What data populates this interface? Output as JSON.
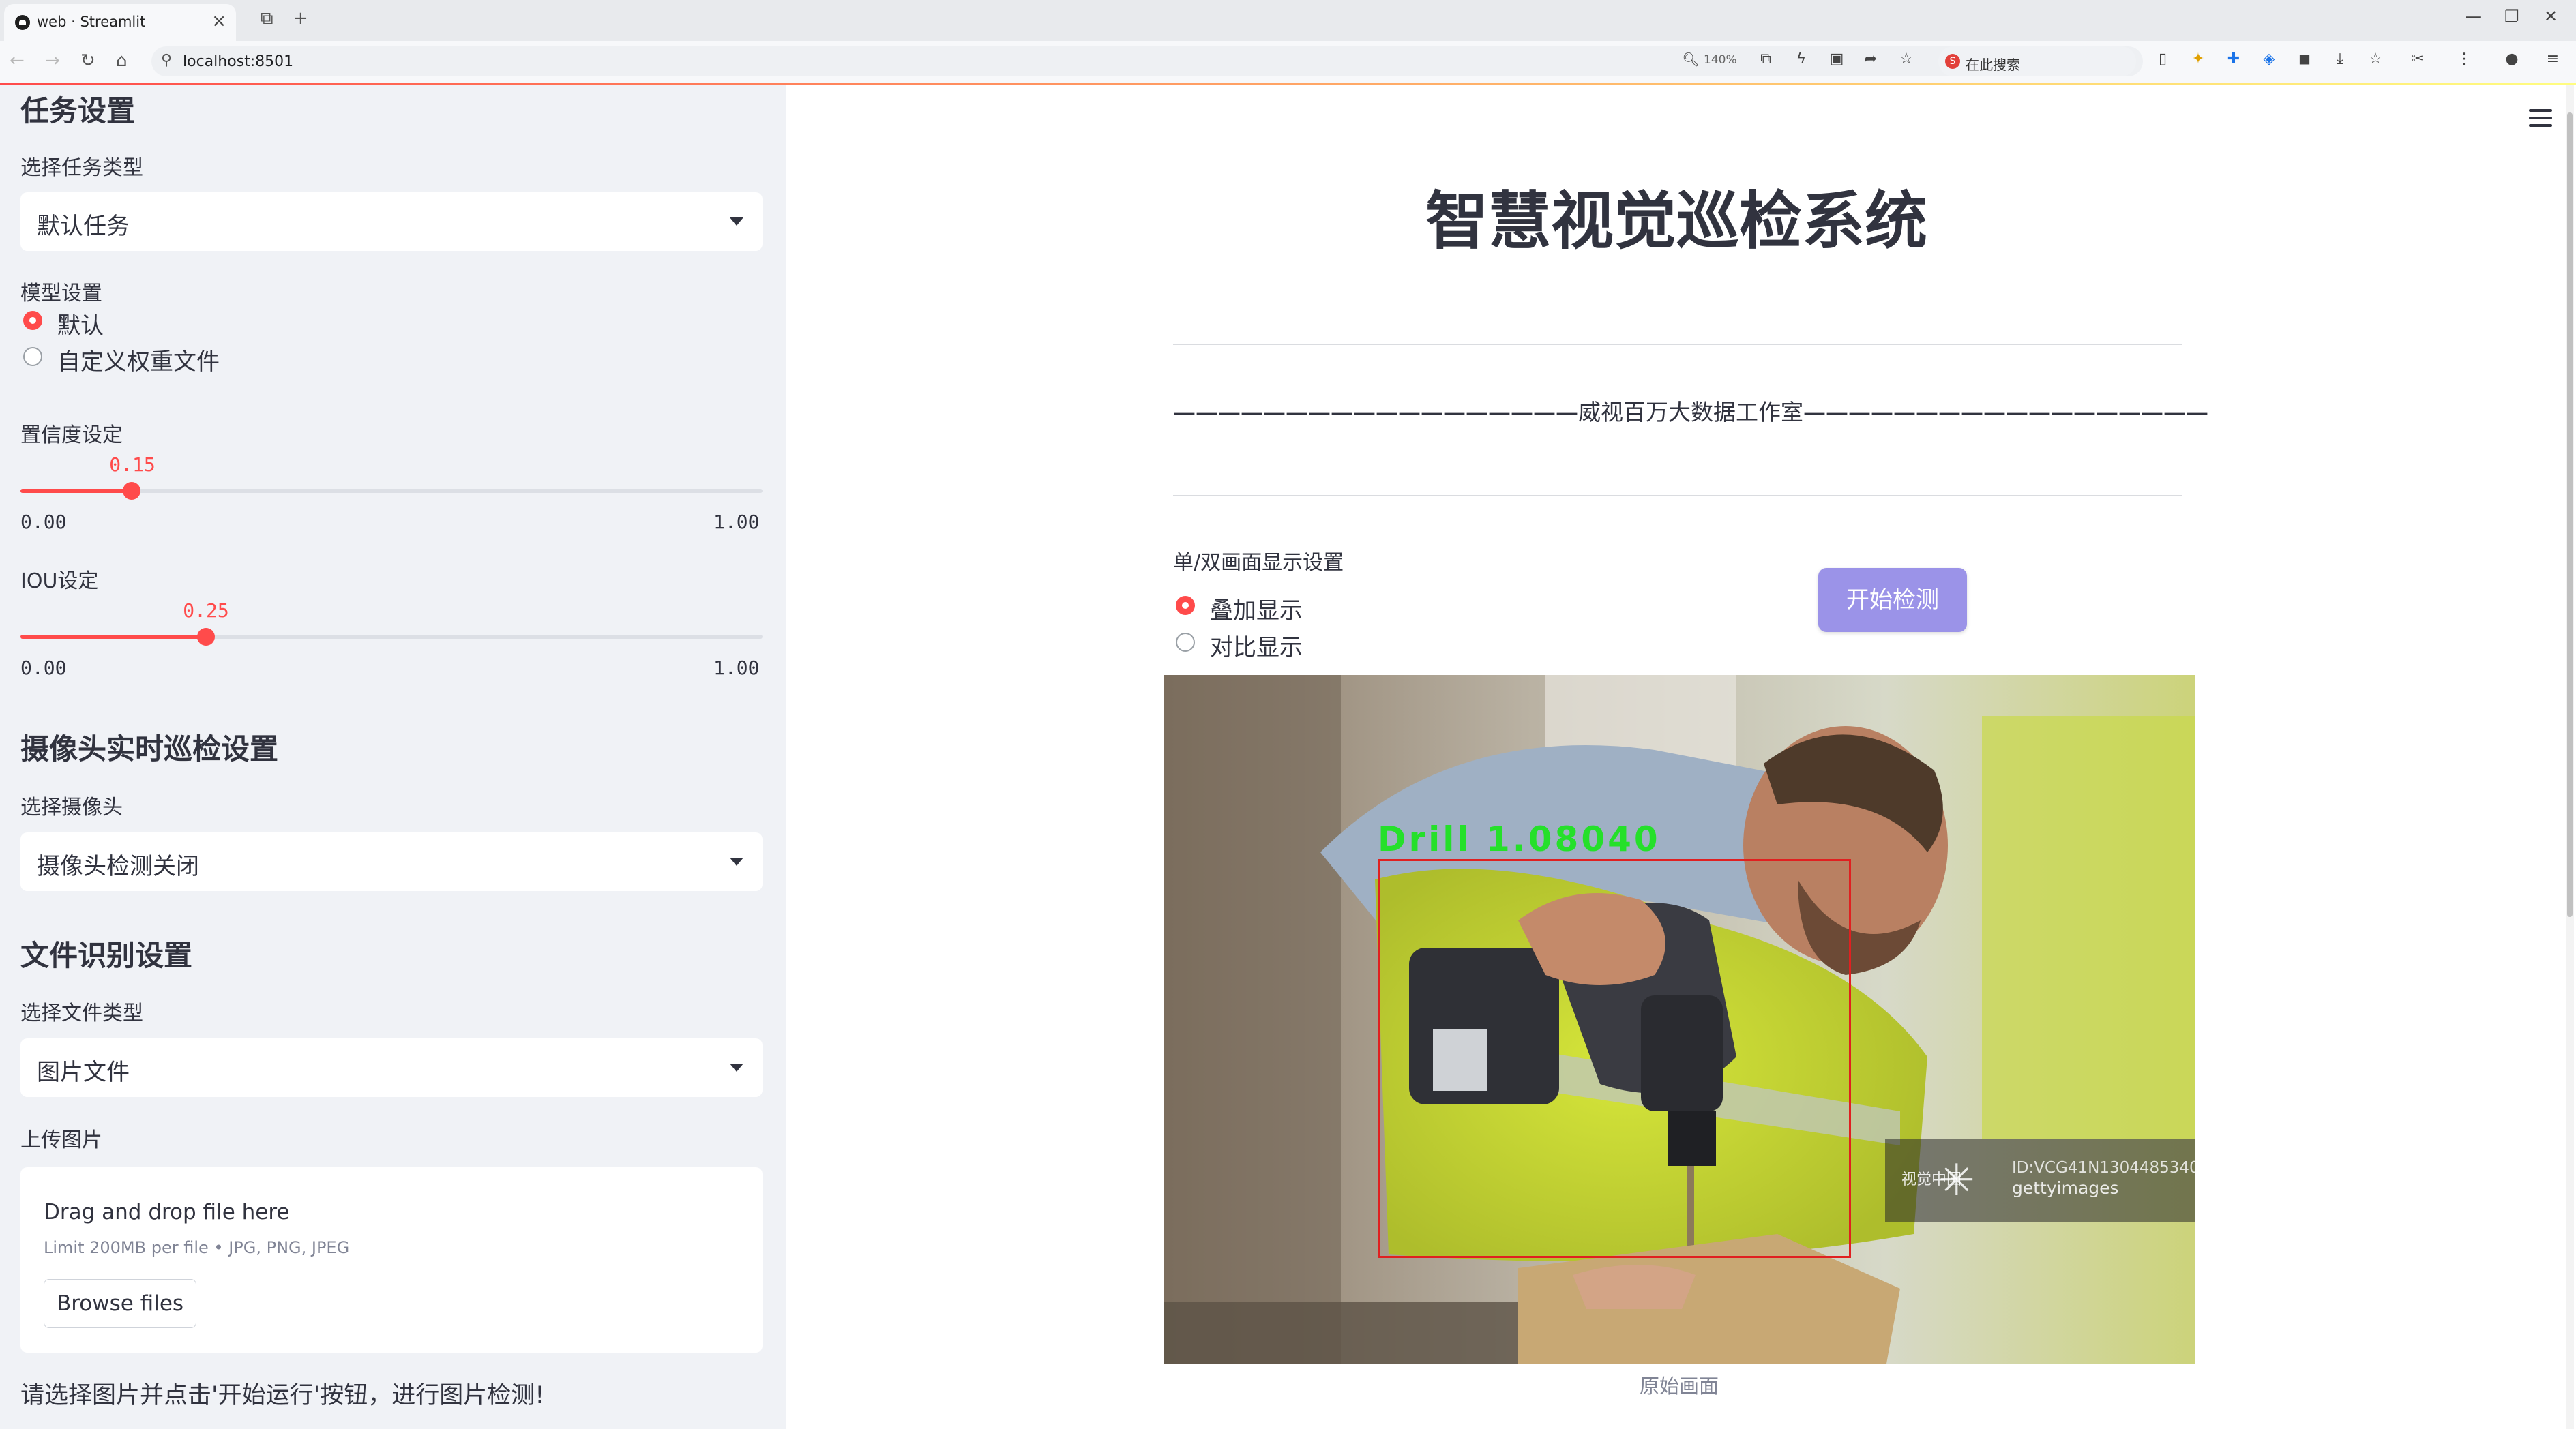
{
  "browser": {
    "tab_title": "web · Streamlit",
    "tab_close": "×",
    "new_tab": "+",
    "url": "localhost:8501",
    "zoom": "140%",
    "search_label": "在此搜索"
  },
  "sidebar": {
    "task_section_title": "任务设置",
    "task_type_label": "选择任务类型",
    "task_type_value": "默认任务",
    "model_label": "模型设置",
    "model_options": [
      "默认",
      "自定义权重文件"
    ],
    "model_selected": 0,
    "confidence_label": "置信度设定",
    "confidence_value": "0.15",
    "confidence_min": "0.00",
    "confidence_max": "1.00",
    "iou_label": "IOU设定",
    "iou_value": "0.25",
    "iou_min": "0.00",
    "iou_max": "1.00",
    "camera_section_title": "摄像头实时巡检设置",
    "camera_label": "选择摄像头",
    "camera_value": "摄像头检测关闭",
    "file_section_title": "文件识别设置",
    "file_type_label": "选择文件类型",
    "file_type_value": "图片文件",
    "upload_label": "上传图片",
    "upload_drag_text": "Drag and drop file here",
    "upload_limit_text": "Limit 200MB per file • JPG, PNG, JPEG",
    "browse_button": "Browse files",
    "instruction_text": "请选择图片并点击'开始运行'按钮，进行图片检测!"
  },
  "main": {
    "title": "智慧视觉巡检系统",
    "subtitle": "——————————————————威视百万大数据工作室——————————————————",
    "display_label": "单/双画面显示设置",
    "display_options": [
      "叠加显示",
      "对比显示"
    ],
    "display_selected": 0,
    "start_button": "开始检测",
    "detection_label": "Drill  1.08040",
    "watermark_left": "视觉中国",
    "watermark_id": "ID:VCG41N1304485340",
    "watermark_brand": "gettyimages",
    "image_caption": "原始画面"
  },
  "colors": {
    "accent": "#ff4b4b",
    "sidebar_bg": "#f0f2f6",
    "button_bg": "#9b93e8",
    "detection_box": "#e02020",
    "detection_text": "#25e02a"
  },
  "icons": [
    "streamlit-favicon",
    "close-icon",
    "tab-search-icon",
    "plus-icon",
    "back-icon",
    "forward-icon",
    "reload-icon",
    "home-icon",
    "lock-icon",
    "zoom-icon",
    "star-icon",
    "download-icon",
    "menu-icon",
    "hamburger-icon"
  ]
}
